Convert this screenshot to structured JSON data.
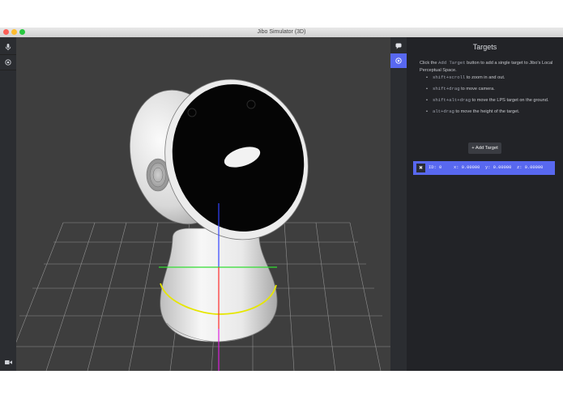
{
  "window": {
    "title": "Jibo Simulator (3D)"
  },
  "left_toolbar": {
    "items": [
      {
        "icon": "microphone-icon"
      },
      {
        "icon": "target-icon"
      },
      {
        "icon": "video-camera-icon"
      }
    ]
  },
  "right_tabs": [
    {
      "icon": "chat-bubble-icon",
      "active": false
    },
    {
      "icon": "target-icon",
      "active": true
    }
  ],
  "panel": {
    "title": "Targets",
    "desc_part1": "Click the ",
    "desc_code": "Add Target",
    "desc_part2": " button to add a single target to Jibo's Local Perceptual Space.",
    "hints": [
      {
        "code": "shift+scroll",
        "text": " to zoom in and out."
      },
      {
        "code": "shift+drag",
        "text": " to move camera."
      },
      {
        "code": "shift+alt+drag",
        "text": " to move the LPS target on the ground."
      },
      {
        "code": "alt+drag",
        "text": " to move the height of the target."
      }
    ],
    "add_button_label": "+ Add Target",
    "target": {
      "delete_glyph": "✖",
      "id_label": "ID: 0",
      "x_label": "x: 0.00000",
      "y_label": "y: 0.00000",
      "z_label": "z: 0.00000"
    }
  },
  "colors": {
    "accent": "#5868f0",
    "viewport_bg": "#3e3e3e",
    "panel_bg": "#222327",
    "axis_x": "#ff2a2a",
    "axis_y": "#33dd33",
    "axis_z": "#3344ff",
    "base_ring": "#e6e600"
  }
}
